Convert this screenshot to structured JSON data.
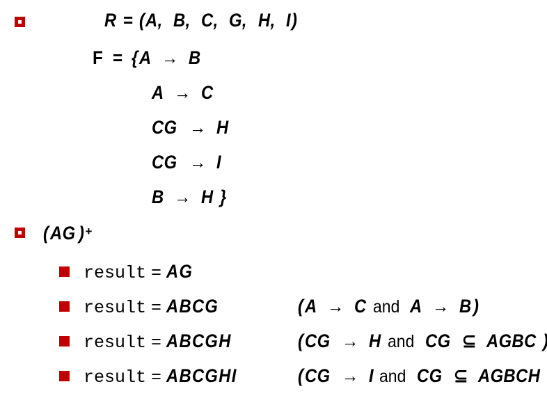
{
  "slide": {
    "colors": {
      "bullet_outline": "#c00000",
      "bullet_fill": "#c00000",
      "text": "#000000",
      "background": "#ffffff"
    },
    "relation_block": {
      "bullet_icon": "hollow-square-bullet",
      "relation_line": {
        "name": "R",
        "equals": "=",
        "open_paren": "(",
        "attributes": [
          "A,",
          "B,",
          "C,",
          "G,",
          "H,",
          "I"
        ],
        "close_paren": ")"
      },
      "fd_set": {
        "name": "F",
        "equals": "=",
        "open_brace": "{",
        "close_brace": "}",
        "arrow": "→",
        "dependencies": [
          {
            "lhs": "A",
            "arrow": "→",
            "rhs": "B"
          },
          {
            "lhs": "A",
            "arrow": "→",
            "rhs": "C"
          },
          {
            "lhs": "CG",
            "arrow": "→",
            "rhs": "H"
          },
          {
            "lhs": "CG",
            "arrow": "→",
            "rhs": "I"
          },
          {
            "lhs": "B",
            "arrow": "→",
            "rhs": "H"
          }
        ]
      }
    },
    "closure_block": {
      "bullet_icon": "hollow-square-bullet",
      "heading": {
        "open_paren": "(",
        "attributes": "AG",
        "close_paren": ")",
        "superscript": "+"
      },
      "steps": [
        {
          "bullet_icon": "solid-square-bullet",
          "label": "result",
          "equals": "=",
          "value": "AG",
          "justification": null
        },
        {
          "bullet_icon": "solid-square-bullet",
          "label": "result",
          "equals": "=",
          "value": "ABCG",
          "justification": {
            "open_paren": "(",
            "first_lhs": "A",
            "first_arrow": "→",
            "first_rhs": "C",
            "conjunction": "and",
            "second_lhs": "A",
            "second_arrow": "→",
            "second_rhs": "B",
            "close_paren": ")"
          }
        },
        {
          "bullet_icon": "solid-square-bullet",
          "label": "result",
          "equals": "=",
          "value": "ABCGH",
          "justification": {
            "open_paren": "(",
            "first_lhs": "CG",
            "first_arrow": "→",
            "first_rhs": "H",
            "conjunction": "and",
            "second_lhs": "CG",
            "second_arrow": "⊆",
            "second_rhs": "AGBC",
            "close_paren": ")"
          }
        },
        {
          "bullet_icon": "solid-square-bullet",
          "label": "result",
          "equals": "=",
          "value": "ABCGHI",
          "justification": {
            "open_paren": "(",
            "first_lhs": "CG",
            "first_arrow": "→",
            "first_rhs": "I",
            "conjunction": "and",
            "second_lhs": "CG",
            "second_arrow": "⊆",
            "second_rhs": "AGBCH",
            "close_paren": ")"
          }
        }
      ]
    }
  }
}
